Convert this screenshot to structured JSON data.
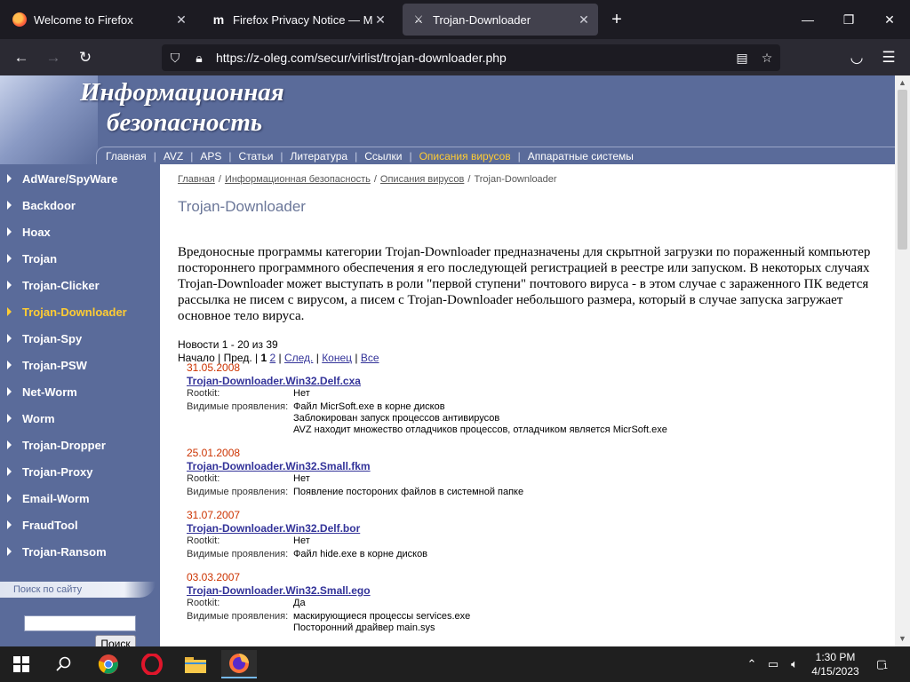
{
  "browser": {
    "tabs": [
      {
        "title": "Welcome to Firefox",
        "favicon": "firefox-icon"
      },
      {
        "title": "Firefox Privacy Notice — Mozill",
        "favicon": "mozilla-m-icon"
      },
      {
        "title": "Trojan-Downloader",
        "favicon": "sword-icon"
      }
    ],
    "url": "https://z-oleg.com/secur/virlist/trojan-downloader.php"
  },
  "site": {
    "title_line1": "Информационная",
    "title_line2": "безопасность",
    "menu": [
      "Главная",
      "AVZ",
      "APS",
      "Статьи",
      "Литература",
      "Ссылки",
      "Описания вирусов",
      "Аппаратные системы"
    ],
    "active_menu": "Описания вирусов",
    "sidebar": [
      "AdWare/SpyWare",
      "Backdoor",
      "Hoax",
      "Trojan",
      "Trojan-Clicker",
      "Trojan-Downloader",
      "Trojan-Spy",
      "Trojan-PSW",
      "Net-Worm",
      "Worm",
      "Trojan-Dropper",
      "Trojan-Proxy",
      "Email-Worm",
      "FraudTool",
      "Trojan-Ransom"
    ],
    "active_sidebar": "Trojan-Downloader",
    "search_label": "Поиск по сайту",
    "search_button": "Поиск",
    "accent_color": "#ffcc33",
    "nav_color": "#5a6b9a"
  },
  "content": {
    "breadcrumb": [
      "Главная",
      "Информационная безопасность",
      "Описания вирусов",
      "Trojan-Downloader"
    ],
    "heading": "Trojan-Downloader",
    "intro": "Вредоносные программы категории Trojan-Downloader предназначены для скрытной загрузки по пораженный компьютер постороннего программного обеспечения я его последующей регистрацией в реестре или запуском. В некоторых случаях Trojan-Downloader может выступать в роли \"первой ступени\" почтового вируса - в этом случае с зараженного ПК ведется рассылка не писем с вирусом, а писем с Trojan-Downloader небольшого размера, который в случае запуска загружает основное тело вируса.",
    "news_count": "Новости 1 - 20 из 39",
    "pager": {
      "start": "Начало",
      "prev": "Пред.",
      "current": "1",
      "page2": "2",
      "next": "След.",
      "end": "Конец",
      "all": "Все"
    },
    "rootkit_label": "Rootkit:",
    "symptoms_label": "Видимые проявления:",
    "entries": [
      {
        "date": "31.05.2008",
        "title": "Trojan-Downloader.Win32.Delf.cxa",
        "rootkit": "Нет",
        "symptoms": [
          "Файл MicrSoft.exe в корне дисков",
          "Заблокирован запуск процессов антивирусов",
          "AVZ находит множество отладчиков процессов, отладчиком является MicrSoft.exe"
        ]
      },
      {
        "date": "25.01.2008",
        "title": "Trojan-Downloader.Win32.Small.fkm",
        "rootkit": "Нет",
        "symptoms": [
          "Появление постороних файлов в системной папке"
        ]
      },
      {
        "date": "31.07.2007",
        "title": "Trojan-Downloader.Win32.Delf.bor",
        "rootkit": "Нет",
        "symptoms": [
          "Файл hide.exe в корне дисков"
        ]
      },
      {
        "date": "03.03.2007",
        "title": "Trojan-Downloader.Win32.Small.ego",
        "rootkit": "Да",
        "symptoms": [
          "маскирующиеся процессы services.exe",
          "Посторонний драйвер main.sys"
        ]
      }
    ]
  },
  "taskbar": {
    "time": "1:30 PM",
    "date": "4/15/2023",
    "notification_count": "1"
  }
}
